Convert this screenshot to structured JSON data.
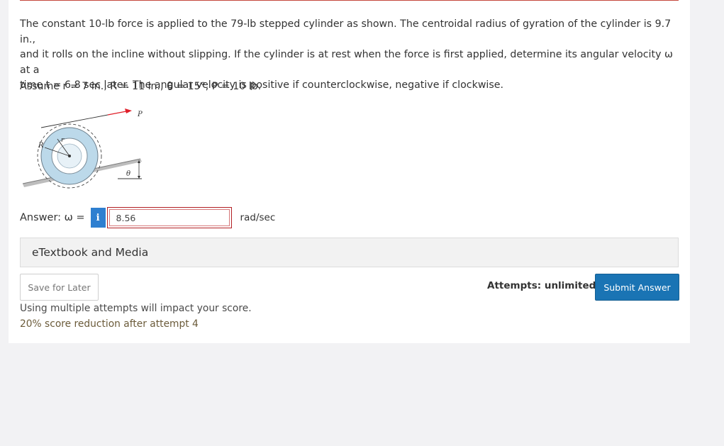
{
  "problem": {
    "line1": "The constant 10-lb force is applied to the 79-lb stepped cylinder as shown. The centroidal radius of gyration of the cylinder is 9.7 in.,",
    "line2": "and it rolls on the incline without slipping. If the cylinder is at rest when the force is first applied, determine its angular velocity ω at a",
    "line3": "time t = 6.8 sec later. The angular velocity is positive if counterclockwise, negative if clockwise.",
    "assume": "Assume r = 7 in., R = 11 in., θ = 15°, P = 10 lb."
  },
  "figure": {
    "label_P": "P",
    "label_R": "R",
    "label_r": "r",
    "label_theta": "θ",
    "arrow_color": "#e0202a",
    "cylinder_color": "#bcd9ea"
  },
  "answer": {
    "label": "Answer: ω =",
    "info_icon": "i",
    "value": "8.56",
    "unit": "rad/sec"
  },
  "etextbook": {
    "label": "eTextbook and Media"
  },
  "actions": {
    "save_label": "Save for Later",
    "attempts_label": "Attempts: unlimited",
    "submit_label": "Submit Answer"
  },
  "notes": {
    "line1": "Using multiple attempts will impact your score.",
    "line2": "20% score reduction after attempt 4"
  }
}
